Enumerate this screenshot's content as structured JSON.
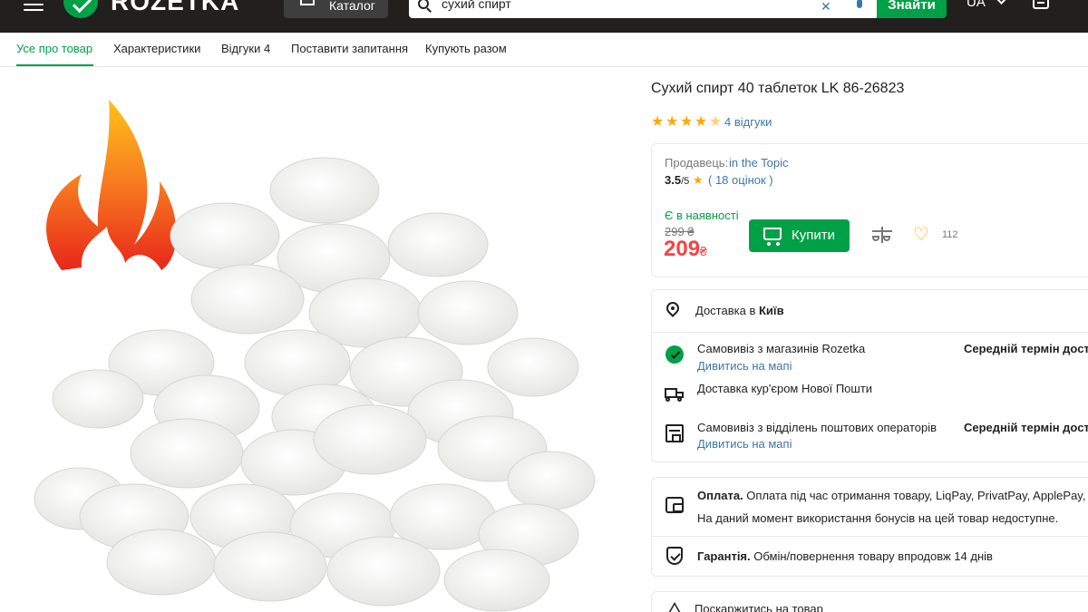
{
  "header": {
    "logo_text": "ROZETKA",
    "catalog_label": "Каталог",
    "search_value": "сухий спирт",
    "search_button": "Знайти",
    "language": "UA",
    "brand_color": "#00a046",
    "icons": [
      "burger-icon",
      "logo-icon",
      "catalog-icon",
      "search-icon",
      "clear-icon",
      "mic-icon",
      "chevron-down-icon",
      "list-icon"
    ]
  },
  "tabs": [
    {
      "label": "Усе про товар",
      "active": true
    },
    {
      "label": "Характеристики"
    },
    {
      "label": "Відгуки 4"
    },
    {
      "label": "Поставити запитання"
    },
    {
      "label": "Купують разом"
    }
  ],
  "product": {
    "title": "Сухий спирт 40 таблеток LK 86-26823",
    "rating_stars": 4.5,
    "reviews_label": "4 відгуки",
    "image_description_icons": [
      "flame-icon",
      "tablets-image"
    ]
  },
  "seller": {
    "label": "Продавець:",
    "name": "in the Topic",
    "rating": "3.5",
    "rating_max": "/5",
    "rating_count": "( 18 оцінок )",
    "availability": "Є в наявності",
    "old_price": "299 ₴",
    "price": "209",
    "currency": "₴",
    "buy_label": "Купити",
    "favorites_count": "112",
    "price_color": "#f84147"
  },
  "delivery": {
    "header_prefix": "Доставка в",
    "city": "Київ",
    "options": [
      {
        "name": "Самовивіз з магазинів Rozetka",
        "link": "Дивитись на мапі",
        "term": "Середній термін доставки"
      },
      {
        "name": "Доставка кур'єром Нової Пошти"
      },
      {
        "name": "Самовивіз з відділень поштових операторів",
        "link": "Дивитись на мапі",
        "term": "Середній термін доставки"
      }
    ]
  },
  "payment": {
    "label": "Оплата.",
    "text": "Оплата під час отримання товару, LiqPay, PrivatPay, ApplePay, Google Pay",
    "bonus": "На даний момент використання бонусів на цей товар недоступне."
  },
  "warranty": {
    "label": "Гарантія.",
    "text": "Обмін/повернення товару впродовж 14 днів"
  },
  "complaint": {
    "text": "Поскаржитись на товар"
  }
}
